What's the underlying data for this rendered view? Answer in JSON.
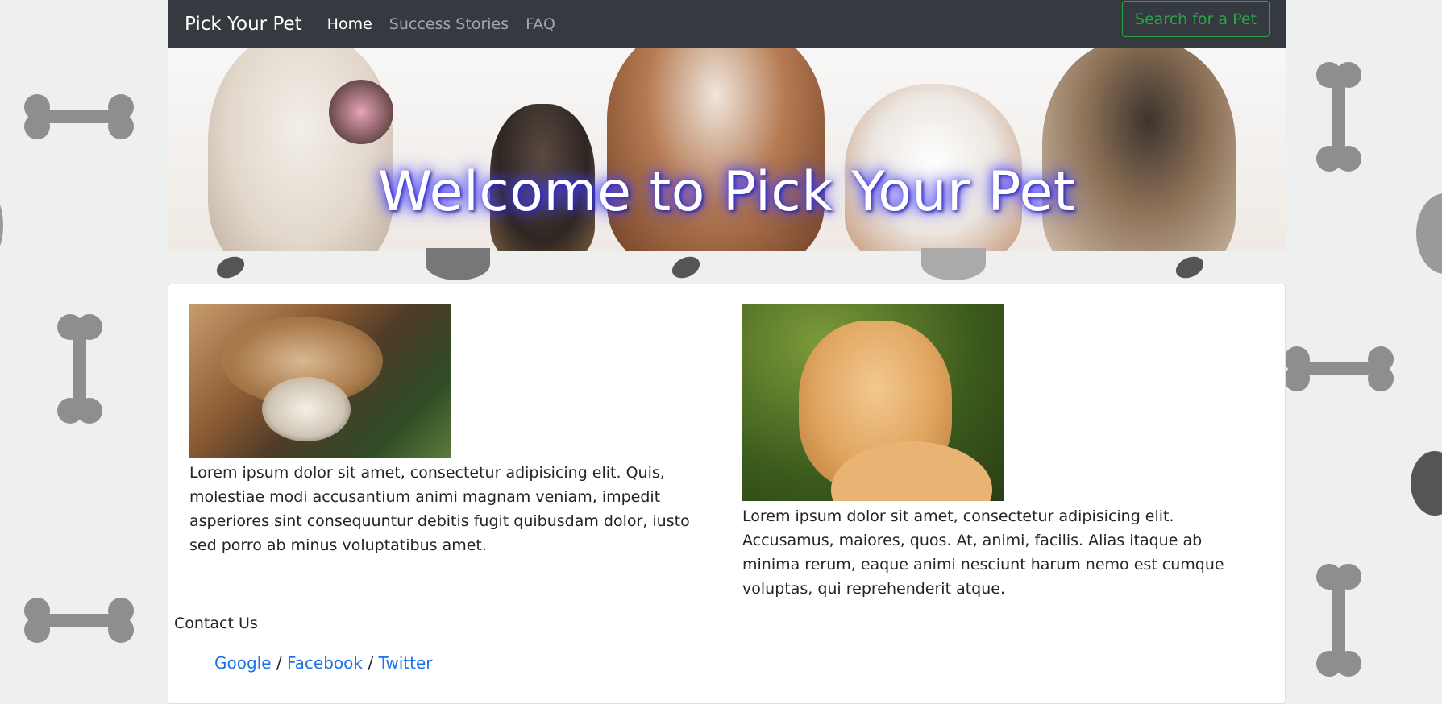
{
  "navbar": {
    "brand": "Pick Your Pet",
    "links": [
      {
        "label": "Home",
        "active": true
      },
      {
        "label": "Success Stories",
        "active": false
      },
      {
        "label": "FAQ",
        "active": false
      }
    ],
    "search_button": "Search for a Pet"
  },
  "hero": {
    "title": "Welcome to Pick Your Pet"
  },
  "features": [
    {
      "image": "cat-and-dog-photo",
      "text": "Lorem ipsum dolor sit amet, consectetur adipisicing elit. Quis, molestiae modi accusantium animi magnam veniam, impedit asperiores sint consequuntur debitis fugit quibusdam dolor, iusto sed porro ab minus voluptatibus amet."
    },
    {
      "image": "golden-retriever-photo",
      "text": "Lorem ipsum dolor sit amet, consectetur adipisicing elit. Accusamus, maiores, quos. At, animi, facilis. Alias itaque ab minima rerum, eaque animi nesciunt harum nemo est cumque voluptas, qui reprehenderit atque."
    }
  ],
  "contact": {
    "title": "Contact Us",
    "links": [
      "Google",
      "Facebook",
      "Twitter"
    ],
    "separator": "/"
  },
  "colors": {
    "navbar_bg": "#343a40",
    "success": "#28a745",
    "link": "#1a73e8",
    "hero_glow": "#3b33ff"
  }
}
